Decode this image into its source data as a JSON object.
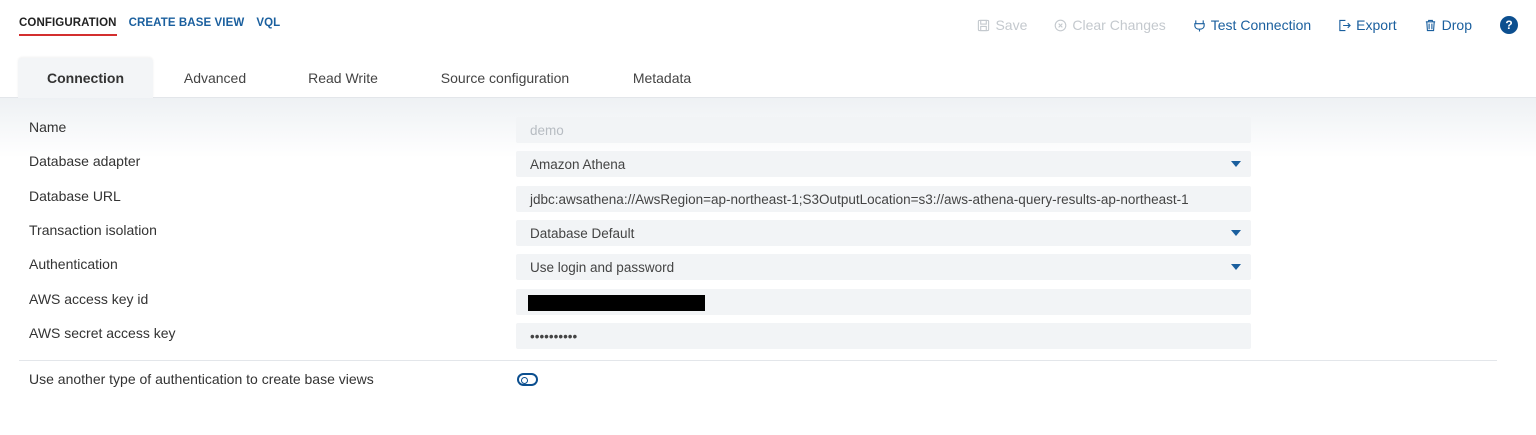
{
  "header": {
    "links": [
      "CONFIGURATION",
      "CREATE BASE VIEW",
      "VQL"
    ],
    "actions": {
      "save": "Save",
      "clear": "Clear Changes",
      "test": "Test Connection",
      "export": "Export",
      "drop": "Drop",
      "help": "?"
    }
  },
  "tabs": [
    "Connection",
    "Advanced",
    "Read Write",
    "Source configuration",
    "Metadata"
  ],
  "form": {
    "name": {
      "label": "Name",
      "value": "demo"
    },
    "adapter": {
      "label": "Database adapter",
      "value": "Amazon Athena"
    },
    "url": {
      "label": "Database URL",
      "value": "jdbc:awsathena://AwsRegion=ap-northeast-1;S3OutputLocation=s3://aws-athena-query-results-ap-northeast-1"
    },
    "isolation": {
      "label": "Transaction isolation",
      "value": "Database Default"
    },
    "auth": {
      "label": "Authentication",
      "value": "Use login and password"
    },
    "access_key": {
      "label": "AWS access key id",
      "value": ""
    },
    "secret_key": {
      "label": "AWS secret access key",
      "value": "••••••••••"
    },
    "other_auth": {
      "label": "Use another type of authentication to create base views"
    }
  },
  "colors": {
    "accent": "#1a5f9e",
    "active_underline": "#d32f2f",
    "field_bg": "#f2f4f6"
  }
}
